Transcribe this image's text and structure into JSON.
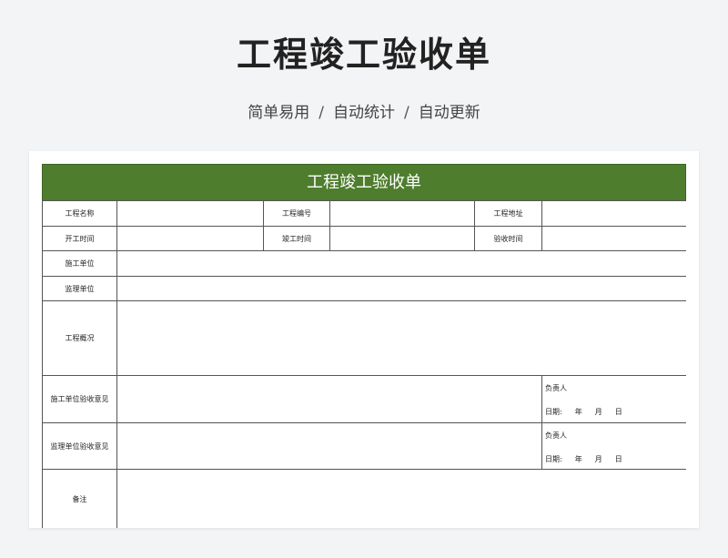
{
  "page": {
    "title": "工程竣工验收单",
    "subtitle_parts": [
      "简单易用",
      "自动统计",
      "自动更新"
    ],
    "separator": "/"
  },
  "form": {
    "title": "工程竣工验收单",
    "rows": {
      "project_name": "工程名称",
      "project_number": "工程编号",
      "project_address": "工程地址",
      "start_time": "开工时间",
      "completion_time": "竣工时间",
      "acceptance_time": "验收时间",
      "construction_unit": "施工单位",
      "supervision_unit": "监理单位",
      "project_overview": "工程概况",
      "construction_opinion": "施工单位验收意见",
      "supervision_opinion": "监理单位验收意见",
      "remarks": "备注"
    },
    "sign": {
      "responsible": "负责人",
      "date": "日期:",
      "year": "年",
      "month": "月",
      "day": "日"
    }
  }
}
